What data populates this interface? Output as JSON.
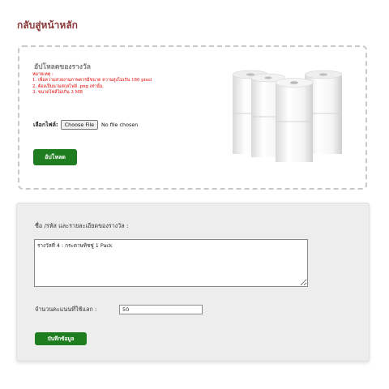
{
  "nav": {
    "back_label": "กลับสู่หน้าหลัก"
  },
  "upload": {
    "title": "อัปโหลดของรางวัล",
    "note_lines": [
      "หมายเหตุ :",
      "1. เพื่อความสวยงามภาพควรมีขนาด ความสูงไม่เกิน 180 pixel",
      "2. ต้องเป็นนามสกุลไฟล์ .png เท่านั้น",
      "3. ขนาดไฟล์ไม่เกิน 3 MB"
    ],
    "file_label": "เลือกไฟล์:",
    "file_button": "Choose File",
    "file_status": "No file chosen",
    "upload_button": "อัปโหลด",
    "product_image_icon": "paper-towel-rolls-image"
  },
  "details": {
    "name_label": "ชื่อ /รหัส และรายละเอียดของรางวัล :",
    "name_value": "รางวัลที่ 4 : กระดาษทิชชู่ 1 Pack",
    "points_label": "จำนวนคะแนนที่ใช้แลก :",
    "points_value": "50",
    "save_button": "บันทึกข้อมูล"
  },
  "colors": {
    "accent_green": "#1e7d1e",
    "back_link": "#8b3a3a",
    "note_red": "#e00000"
  }
}
